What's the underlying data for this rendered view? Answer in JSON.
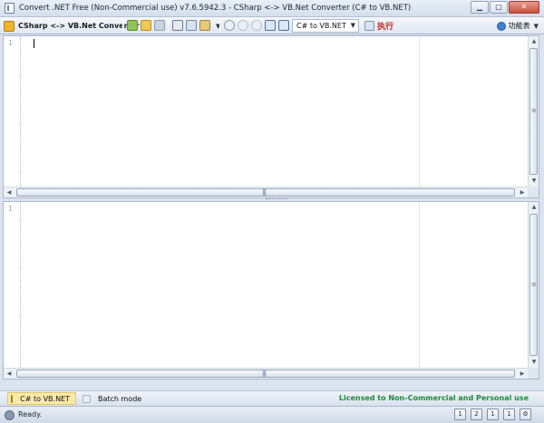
{
  "window": {
    "title": "Convert .NET Free (Non-Commercial use) v7.6.5942.3 - CSharp <-> VB.Net Converter (C# to VB.NET)",
    "controls": {
      "minimize": "▁",
      "maximize": "▢",
      "close": "✕"
    }
  },
  "toolbar": {
    "converter_menu_label": "CSharp <-> VB.Net Converter",
    "direction_select_value": "C# to VB.NET",
    "run_label": "执行",
    "functions_label": "功能表",
    "icons": [
      "clipboard-icon",
      "open-icon",
      "save-icon",
      "cut-icon",
      "copy-icon",
      "paste-icon",
      "clear-icon",
      "undo-icon",
      "redo-icon",
      "indent-icon",
      "outdent-icon"
    ]
  },
  "editors": {
    "source": {
      "line_number": "1",
      "content": ""
    },
    "output": {
      "line_number": "1",
      "content": ""
    }
  },
  "tabs": {
    "active_label": "C# to VB.NET",
    "batch_label": "Batch mode"
  },
  "license_text": "Licensed to Non-Commercial and Personal use",
  "status": {
    "text": "Ready.",
    "buttons": [
      "1",
      "2",
      "1",
      "1",
      "⚙"
    ]
  },
  "colors": {
    "accent": "#f0b431",
    "license": "#1c8a3a",
    "run": "#c0281c"
  }
}
